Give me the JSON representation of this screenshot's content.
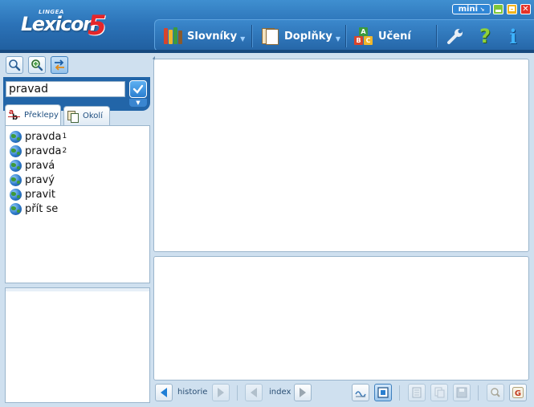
{
  "app": {
    "logo_brand": "LINGEA",
    "logo_name": "Lexicon",
    "logo_version": "5"
  },
  "window_controls": {
    "mini_label": "mini",
    "close_glyph": "✕"
  },
  "menu": {
    "items": [
      {
        "label": "Slovníky",
        "icon": "books-icon",
        "caret": "▼"
      },
      {
        "label": "Doplňky",
        "icon": "document-icon",
        "caret": "▼"
      },
      {
        "label": "Učení",
        "icon": "abc-blocks-icon"
      }
    ],
    "tools": [
      {
        "icon": "wrench-icon"
      },
      {
        "icon": "help-icon",
        "glyph": "?"
      },
      {
        "icon": "info-icon",
        "glyph": "i"
      }
    ]
  },
  "search": {
    "value": "pravad",
    "placeholder": ""
  },
  "tabs": [
    {
      "label": "Překlepy",
      "icon": "spellcheck-icon",
      "active": true
    },
    {
      "label": "Okolí",
      "icon": "neighbors-icon",
      "active": false
    }
  ],
  "results": [
    {
      "word": "pravda",
      "sup": "1"
    },
    {
      "word": "pravda",
      "sup": "2"
    },
    {
      "word": "pravá",
      "sup": ""
    },
    {
      "word": "pravý",
      "sup": ""
    },
    {
      "word": "pravit",
      "sup": ""
    },
    {
      "word": "přít se",
      "sup": ""
    }
  ],
  "bottombar": {
    "history_label": "historie",
    "index_label": "index"
  },
  "colors": {
    "header": "#2c73b8",
    "accent": "#1f7fd6",
    "logo_red": "#e5262a"
  }
}
